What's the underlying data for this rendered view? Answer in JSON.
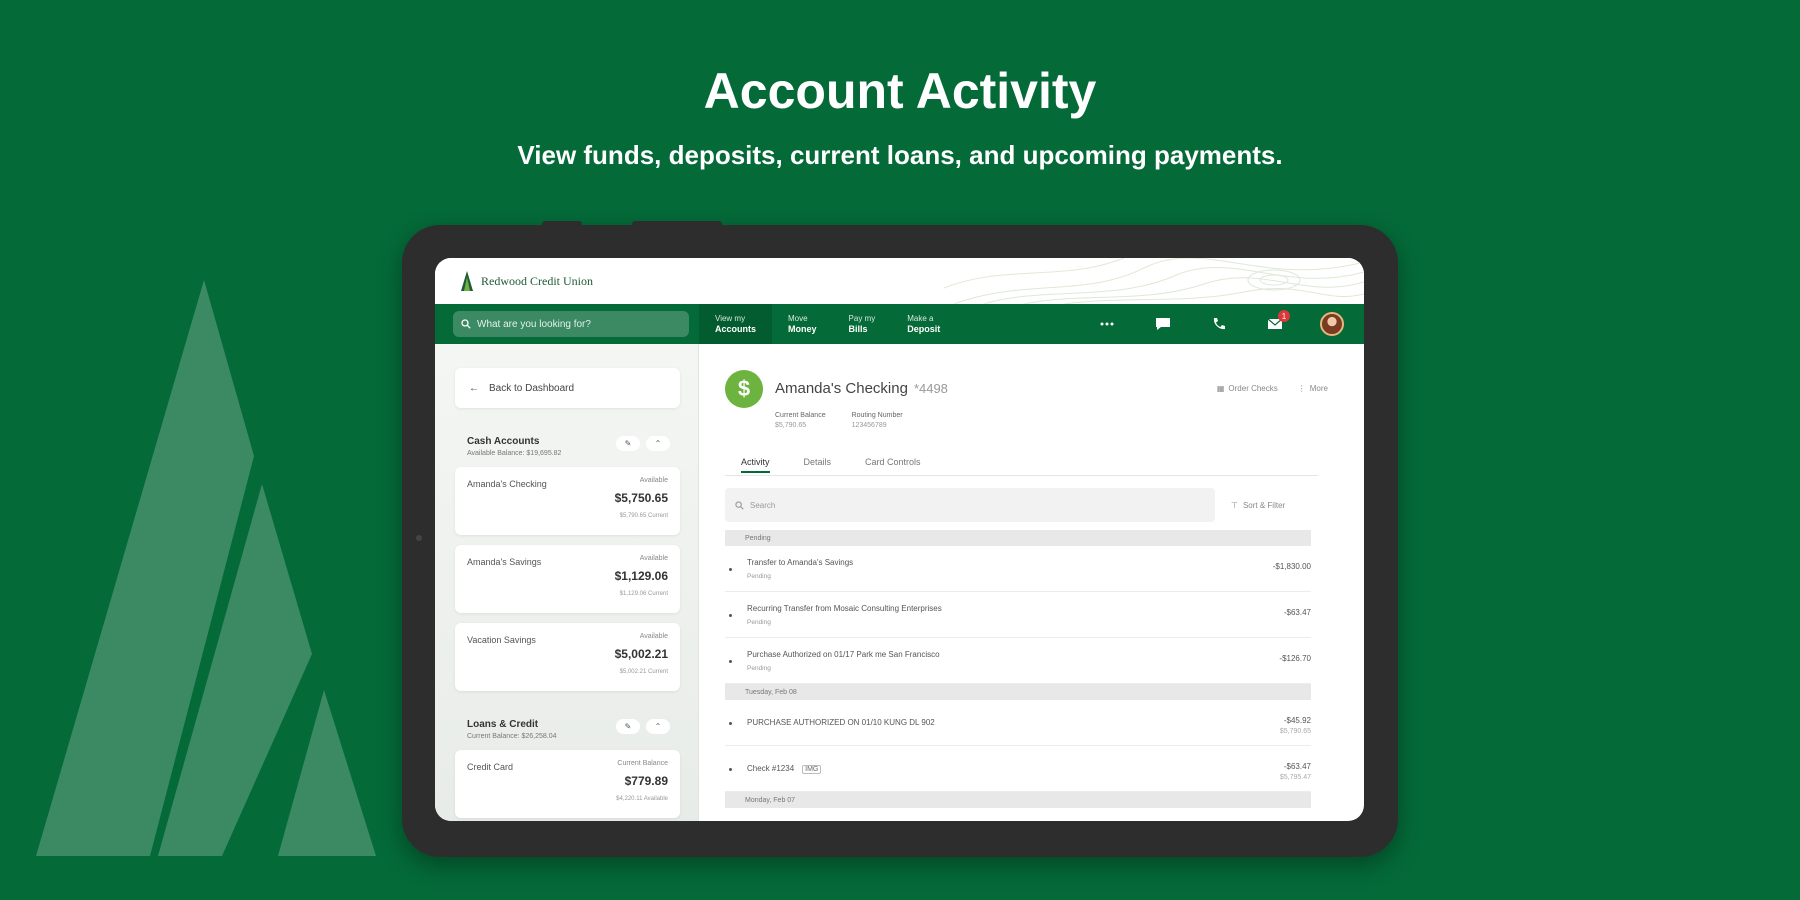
{
  "promo": {
    "title": "Account Activity",
    "subtitle": "View funds, deposits, current loans, and upcoming payments."
  },
  "colors": {
    "brand_green": "#046a38",
    "accent_green": "#6cb33f",
    "badge_red": "#d93838"
  },
  "app": {
    "logo_name": "Redwood Credit Union",
    "search_placeholder": "What are you looking for?",
    "nav": [
      {
        "line1": "View my",
        "line2": "Accounts",
        "active": true
      },
      {
        "line1": "Move",
        "line2": "Money",
        "active": false
      },
      {
        "line1": "Pay my",
        "line2": "Bills",
        "active": false
      },
      {
        "line1": "Make a",
        "line2": "Deposit",
        "active": false
      }
    ],
    "icons": {
      "more": "more-icon",
      "chat": "chat-icon",
      "phone": "phone-icon",
      "inbox": "inbox-icon",
      "avatar": "avatar"
    },
    "inbox_badge": "1"
  },
  "sidebar": {
    "back_label": "Back to Dashboard",
    "cash": {
      "title": "Cash Accounts",
      "subtitle": "Available Balance: $19,695.82",
      "accounts": [
        {
          "name": "Amanda's Checking",
          "label": "Available",
          "amount": "$5,750.65",
          "sub": "$5,790.65 Current"
        },
        {
          "name": "Amanda's Savings",
          "label": "Available",
          "amount": "$1,129.06",
          "sub": "$1,129.06 Current"
        },
        {
          "name": "Vacation Savings",
          "label": "Available",
          "amount": "$5,002.21",
          "sub": "$5,002.21 Current"
        }
      ]
    },
    "loans": {
      "title": "Loans & Credit",
      "subtitle": "Current Balance: $26,258.04",
      "accounts": [
        {
          "name": "Credit Card",
          "label": "Current Balance",
          "amount": "$779.89",
          "sub": "$4,220.11 Available"
        }
      ]
    }
  },
  "account": {
    "name": "Amanda's Checking",
    "number": "*4498",
    "current_balance_label": "Current Balance",
    "current_balance_value": "$5,790.65",
    "routing_label": "Routing Number",
    "routing_value": "123456789",
    "actions": {
      "order_checks": "Order Checks",
      "more": "More"
    },
    "tabs": [
      "Activity",
      "Details",
      "Card Controls"
    ],
    "search_placeholder": "Search",
    "filter_label": "Sort & Filter",
    "groups": [
      {
        "label": "Pending",
        "items": [
          {
            "desc": "Transfer to Amanda's Savings",
            "status": "Pending",
            "amount": "-$1,830.00",
            "balance": ""
          },
          {
            "desc": "Recurring Transfer from Mosaic Consulting Enterprises",
            "status": "Pending",
            "amount": "-$63.47",
            "balance": ""
          },
          {
            "desc": "Purchase Authorized on 01/17 Park me San Francisco",
            "status": "Pending",
            "amount": "-$126.70",
            "balance": ""
          }
        ]
      },
      {
        "label": "Tuesday, Feb 08",
        "items": [
          {
            "desc": "PURCHASE AUTHORIZED ON 01/10 KUNG DL 902",
            "status": "",
            "amount": "-$45.92",
            "balance": "$5,790.65"
          },
          {
            "desc": "Check #1234",
            "status": "",
            "amount": "-$63.47",
            "balance": "$5,795.47",
            "tag": "IMG"
          }
        ]
      },
      {
        "label": "Monday, Feb 07",
        "items": []
      }
    ]
  }
}
